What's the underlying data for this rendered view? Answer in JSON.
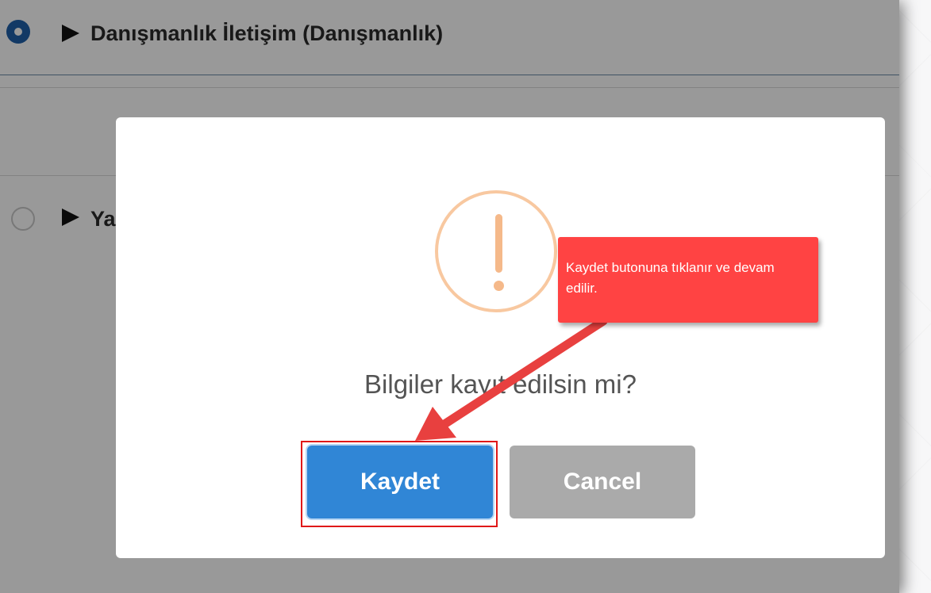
{
  "list": {
    "items": [
      {
        "label": "Danışmanlık İletişim (Danışmanlık)",
        "selected": true
      },
      {
        "label": "Ya",
        "selected": false
      }
    ]
  },
  "dialog": {
    "icon": "warning-icon",
    "message": "Bilgiler kayıt edilsin mi?",
    "confirm_label": "Kaydet",
    "cancel_label": "Cancel"
  },
  "annotation": {
    "text": "Kaydet butonuna tıklanır ve devam edilir."
  },
  "colors": {
    "confirm": "#3086d6",
    "cancel": "#aaaaaa",
    "warning": "#f8bb86",
    "callout": "#ff4343",
    "highlight": "#e01818"
  }
}
